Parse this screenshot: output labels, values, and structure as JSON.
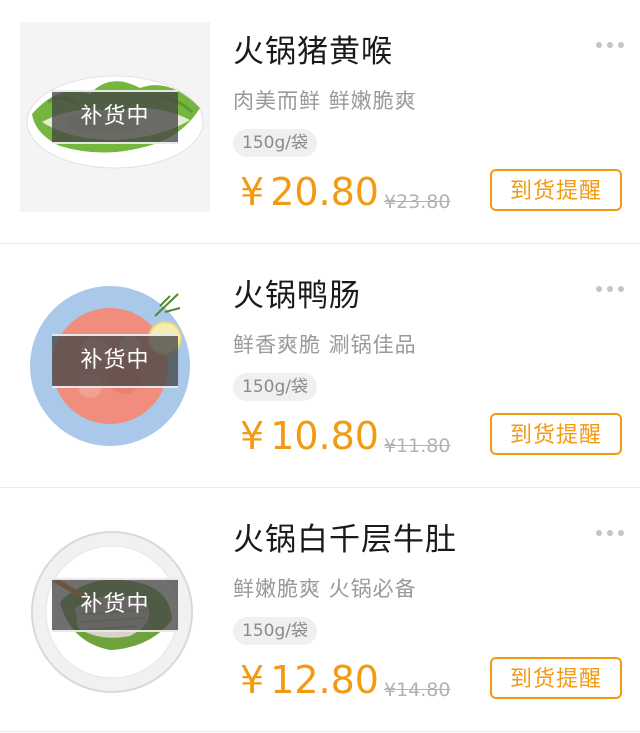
{
  "products": [
    {
      "title": "火锅猪黄喉",
      "desc": "肉美而鲜 鲜嫩脆爽",
      "spec": "150g/袋",
      "currency": "¥",
      "price": "20.80",
      "old_price": "¥23.80",
      "badge": "补货中",
      "notify": "到货提醒"
    },
    {
      "title": "火锅鸭肠",
      "desc": "鲜香爽脆 涮锅佳品",
      "spec": "150g/袋",
      "currency": "¥",
      "price": "10.80",
      "old_price": "¥11.80",
      "badge": "补货中",
      "notify": "到货提醒"
    },
    {
      "title": "火锅白千层牛肚",
      "desc": "鲜嫩脆爽 火锅必备",
      "spec": "150g/袋",
      "currency": "¥",
      "price": "12.80",
      "old_price": "¥14.80",
      "badge": "补货中",
      "notify": "到货提醒"
    }
  ],
  "colors": {
    "accent": "#f29a12",
    "muted_text": "#9a9a9a",
    "badge_bg": "#464646"
  },
  "icons": {
    "more": "more-dots-icon"
  }
}
